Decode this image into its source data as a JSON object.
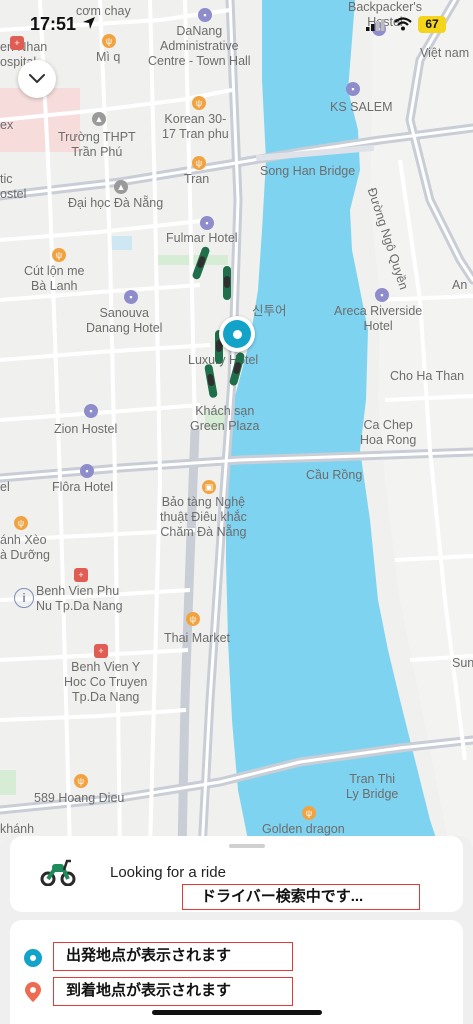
{
  "status_bar": {
    "time": "17:51",
    "battery": "67"
  },
  "map": {
    "labels": {
      "cong_chay": "cơm chay",
      "bv_nhan": "en Nhan\nospital",
      "mi_q": "Mì q",
      "danang_admin": "DaNang\nAdministrative\nCentre - Town Hall",
      "backpackers": "Backpacker's\nHostel",
      "viet_nam": "Việt nam",
      "ex": "ex",
      "korean": "Korean 30-\n17 Tran phu",
      "ks_salem": "KS SALEM",
      "thpt": "Trường THPT\nTrần Phú",
      "tic": "tic\nostel",
      "tran": "Tran",
      "song_han": "Song Han Bridge",
      "duong_ngo": "Đường Ngô Quyền",
      "daihoc": "Đại học Đà Nẵng",
      "fulmar": "Fulmar Hotel",
      "cut_lon": "Cút lộn me\nBà Lanh",
      "sinuoi": "신투어",
      "areca": "Areca Riverside\nHotel",
      "an": "An",
      "sanouva": "Sanouva\nDanang Hotel",
      "luxury": "Luxury Hotel",
      "cho_ha_than": "Cho Ha Than",
      "khach_san": "Khách sạn\nGreen Plaza",
      "ca_chep": "Ca Chep\nHoa Rong",
      "zion": "Zion Hostel",
      "cau_rong": "Cầu Rồng",
      "el": "el",
      "flora": "Flôra Hotel",
      "bao_tang": "Bảo tàng Nghệ\nthuật Điêu khắc\nChăm Đà Nẵng",
      "banh_xeo": "ánh Xèo\nà Dưỡng",
      "bv_phu_nu": "Benh Vien Phu\nNu Tp.Da Nang",
      "thai_market": "Thai Market",
      "sun": "Sun",
      "bv_y_hoc": "Benh Vien Y\nHoc Co Truyen\nTp.Da Nang",
      "tran_thi_ly": "Tran Thi\nLy Bridge",
      "hoang_dieu": "589 Hoang Dieu",
      "khanh": "khánh",
      "golden_dragon": "Golden dragon"
    }
  },
  "sheet": {
    "looking_text": "Looking for a ride",
    "searching_note": "ドライバー検索中です...",
    "origin_note": "出発地点が表示されます",
    "destination_note": "到着地点が表示されます"
  },
  "colors": {
    "accent": "#13a3c9",
    "river": "#7ed3f0",
    "note_border": "#e53935",
    "destination": "#ee6a50"
  }
}
